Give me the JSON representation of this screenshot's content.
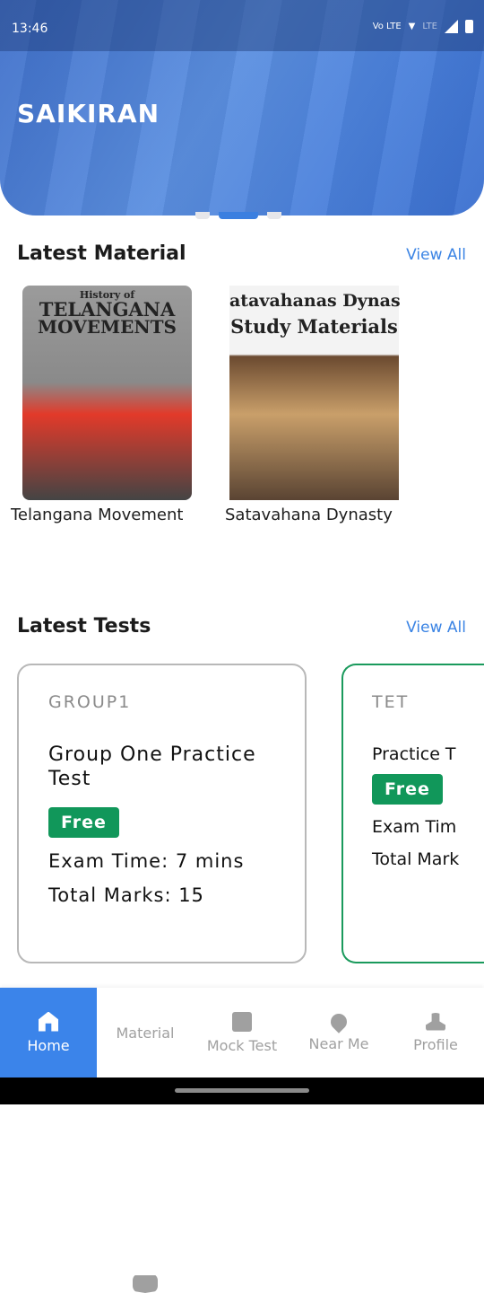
{
  "status_bar": {
    "time": "13:46",
    "volte": "Vo LTE",
    "network": "LTE"
  },
  "hero": {
    "title": "SAIKIRAN"
  },
  "latest_material": {
    "title": "Latest Material",
    "view_all": "View All",
    "items": [
      {
        "label": "Telangana Movement",
        "cover_lines": [
          "History of",
          "TELANGANA",
          "MOVEMENTS"
        ]
      },
      {
        "label": "Satavahana Dynasty",
        "cover_lines": [
          "atavahanas Dynas",
          "Study Materials"
        ]
      }
    ]
  },
  "latest_tests": {
    "title": "Latest Tests",
    "view_all": "View All",
    "items": [
      {
        "category": "GROUP1",
        "name": "Group One Practice Test",
        "badge": "Free",
        "exam_time": "Exam Time: 7 mins",
        "total_marks": "Total Marks: 15"
      },
      {
        "category": "TET",
        "name": "Practice T",
        "badge": "Free",
        "exam_time": "Exam Tim",
        "total_marks": "Total Mark"
      }
    ]
  },
  "bottom_nav": [
    {
      "label": "Home",
      "icon": "home-icon",
      "active": true
    },
    {
      "label": "Material",
      "icon": "book-icon"
    },
    {
      "label": "Mock Test",
      "icon": "document-icon"
    },
    {
      "label": "Near Me",
      "icon": "location-pin-icon"
    },
    {
      "label": "Profile",
      "icon": "person-icon"
    }
  ],
  "colors": {
    "accent": "#3b84ea",
    "free_badge": "#11975a",
    "hero": "#4c82dc"
  }
}
